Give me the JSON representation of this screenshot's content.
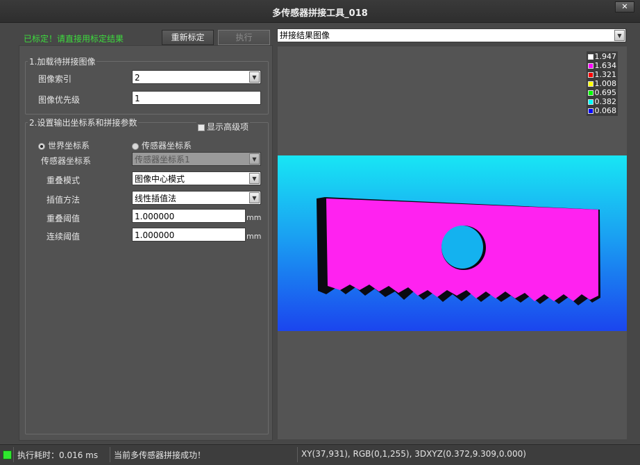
{
  "window": {
    "title": "多传感器拼接工具_018",
    "close_label": "✕"
  },
  "toolbar": {
    "status_message": "已标定！请直接用标定结果",
    "recalibrate_label": "重新标定",
    "execute_label": "执行"
  },
  "group1": {
    "title": "1.加载待拼接图像",
    "image_index_label": "图像索引",
    "image_index_value": "2",
    "image_priority_label": "图像优先级",
    "image_priority_value": "1"
  },
  "group2": {
    "title": "2.设置输出坐标系和拼接参数",
    "show_advanced_label": "显示高级项",
    "world_coord_label": "世界坐标系",
    "sensor_coord_label": "传感器坐标系",
    "sensor_coord_field_label": "传感器坐标系",
    "sensor_coord_field_value": "传感器坐标系1",
    "overlap_mode_label": "重叠模式",
    "overlap_mode_value": "图像中心模式",
    "interp_label": "插值方法",
    "interp_value": "线性插值法",
    "overlap_threshold_label": "重叠阈值",
    "overlap_threshold_value": "1.000000",
    "continuity_threshold_label": "连续阈值",
    "continuity_threshold_value": "1.000000",
    "unit": "mm"
  },
  "viewer": {
    "dropdown_value": "拼接结果图像",
    "legend": [
      {
        "value": "1.947",
        "color": "#ffffff"
      },
      {
        "value": "1.634",
        "color": "#ff00ff"
      },
      {
        "value": "1.321",
        "color": "#ff0000"
      },
      {
        "value": "1.008",
        "color": "#ffff00"
      },
      {
        "value": "0.695",
        "color": "#00ff00"
      },
      {
        "value": "0.382",
        "color": "#00ffff"
      },
      {
        "value": "0.068",
        "color": "#0000ff"
      }
    ]
  },
  "statusbar": {
    "exec_time": "执行耗时：0.016 ms",
    "message": "当前多传感器拼接成功！",
    "pixel_info": "XY(37,931), RGB(0,1,255), 3DXYZ(0.372,9.309,0.000)"
  }
}
